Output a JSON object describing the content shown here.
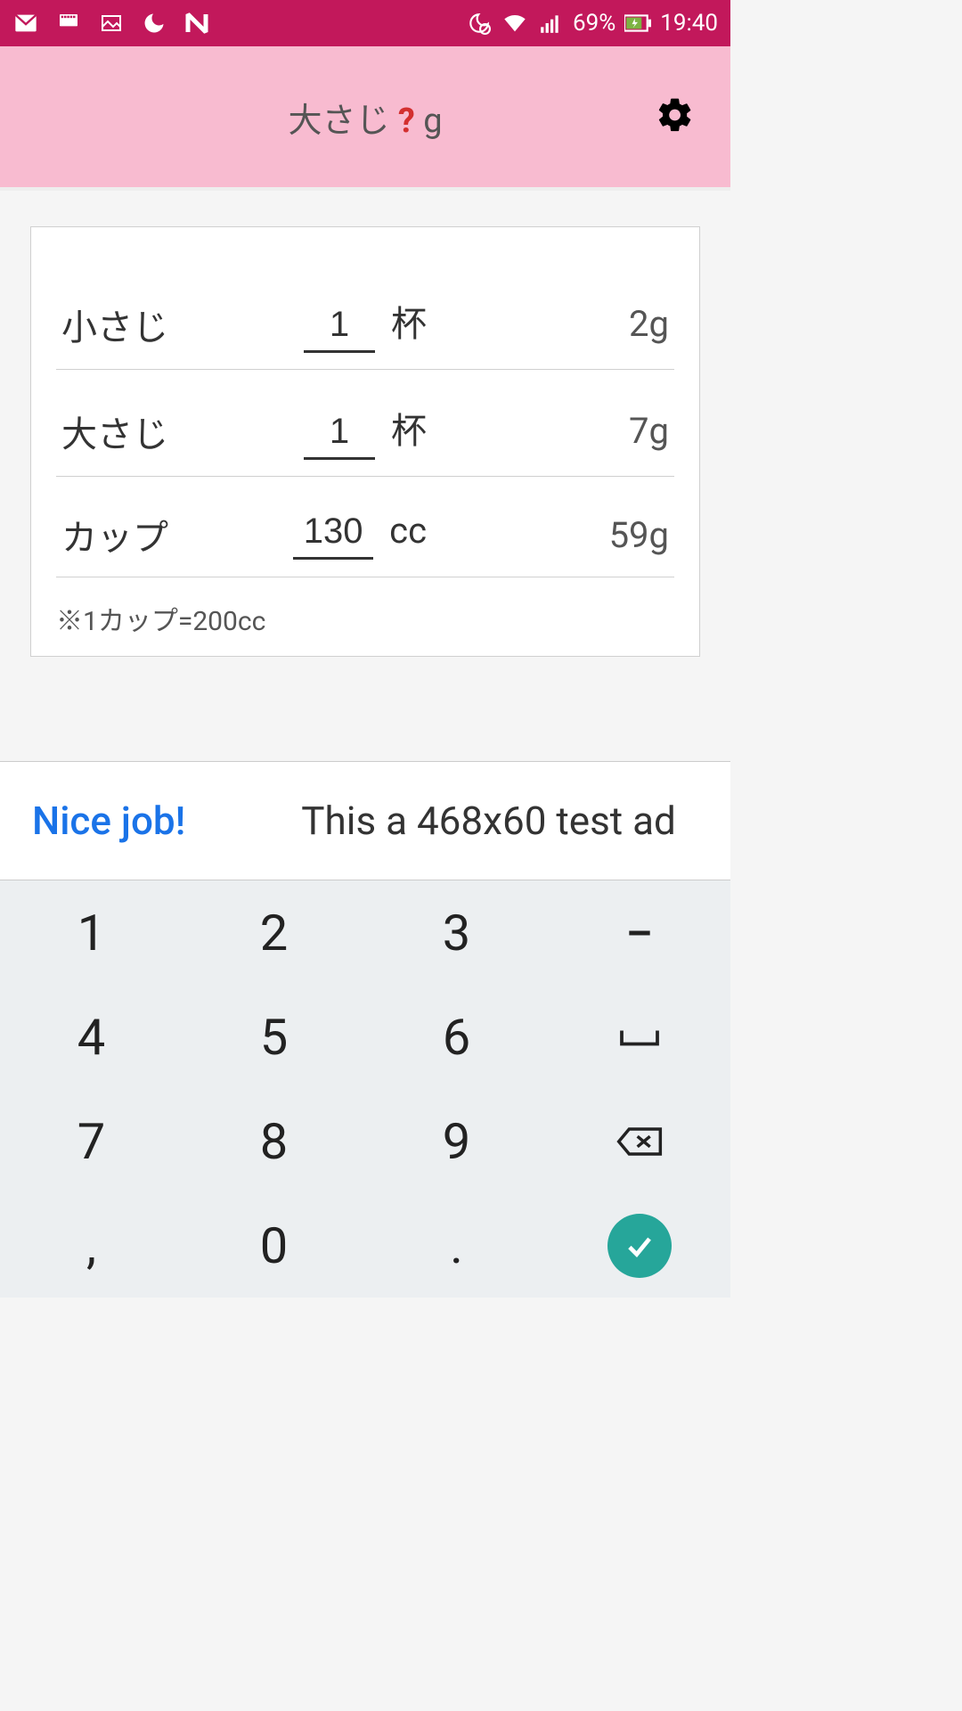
{
  "status_bar": {
    "battery_pct": "69%",
    "time": "19:40"
  },
  "header": {
    "title_pre": "大さじ ",
    "title_q": "?",
    "title_post": " g"
  },
  "rows": [
    {
      "label": "小さじ",
      "value": "1",
      "unit": "杯",
      "result": "2g"
    },
    {
      "label": "大さじ",
      "value": "1",
      "unit": "杯",
      "result": "7g"
    },
    {
      "label": "カップ",
      "value": "130",
      "unit": "cc",
      "result": "59g"
    }
  ],
  "note": "※1カップ=200cc",
  "ad": {
    "blue": "Nice job!",
    "text": "This a 468x60 test ad"
  },
  "keyboard": {
    "keys": [
      [
        "1",
        "2",
        "3",
        "−"
      ],
      [
        "4",
        "5",
        "6",
        "⌴"
      ],
      [
        "7",
        "8",
        "9",
        "⌫"
      ],
      [
        ",",
        "0",
        ".",
        "✓"
      ]
    ]
  }
}
